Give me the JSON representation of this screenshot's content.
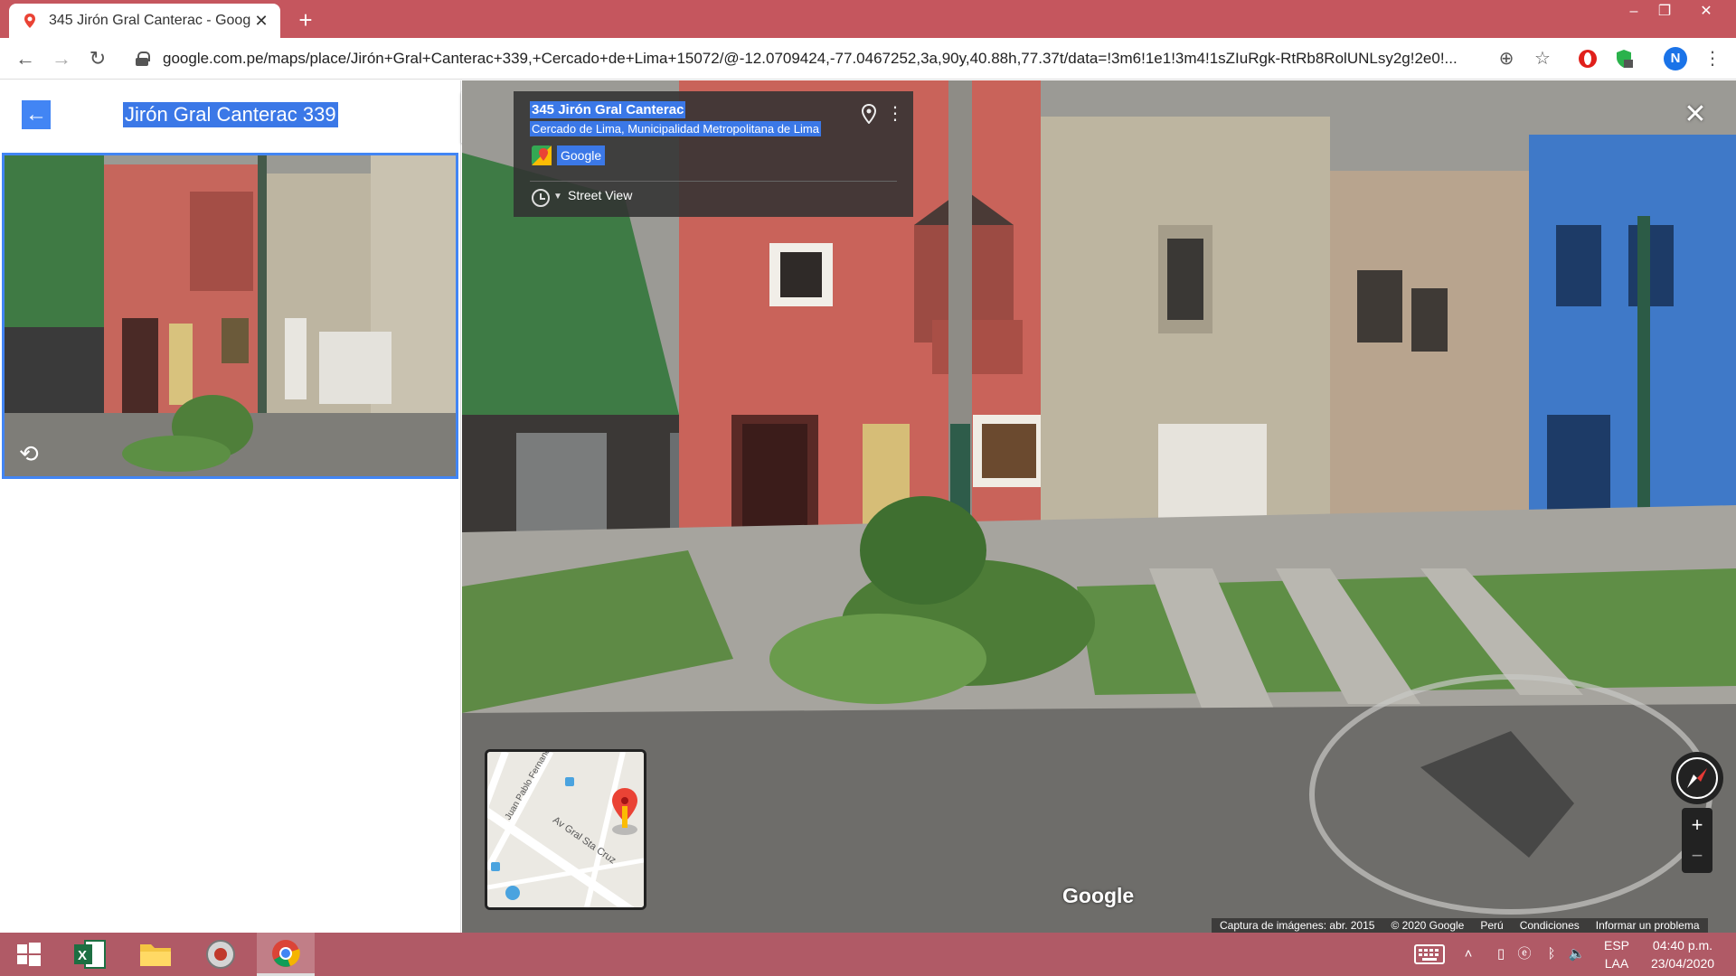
{
  "browser": {
    "tab_title": "345 Jirón Gral Canterac - Google",
    "url": "google.com.pe/maps/place/Jirón+Gral+Canterac+339,+Cercado+de+Lima+15072/@-12.0709424,-77.0467252,3a,90y,40.88h,77.37t/data=!3m6!1e1!3m4!1sZIuRgk-RtRb8RolUNLsy2g!2e0!...",
    "avatar_letter": "N"
  },
  "left_panel": {
    "title": "Jirón Gral Canterac 339"
  },
  "info_card": {
    "address_line1": "345 Jirón Gral Canterac",
    "address_line2": "Cercado de Lima, Municipalidad Metropolitana de Lima",
    "provider": "Google",
    "view_label": "Street View"
  },
  "minimap": {
    "labels": [
      "Av Gral Sta Cruz",
      "Juan Pablo Fernand"
    ]
  },
  "watermark": "Google",
  "attribution": {
    "imagery": "Captura de imágenes: abr. 2015",
    "copyright": "© 2020 Google",
    "country": "Perú",
    "terms": "Condiciones",
    "report": "Informar un problema"
  },
  "taskbar": {
    "lang_top": "ESP",
    "lang_bottom": "LAA",
    "time": "04:40 p.m.",
    "date": "23/04/2020"
  },
  "colors": {
    "tabstrip": "#c5565e",
    "taskbar": "#b05a66",
    "accent_blue": "#3b78e7"
  }
}
